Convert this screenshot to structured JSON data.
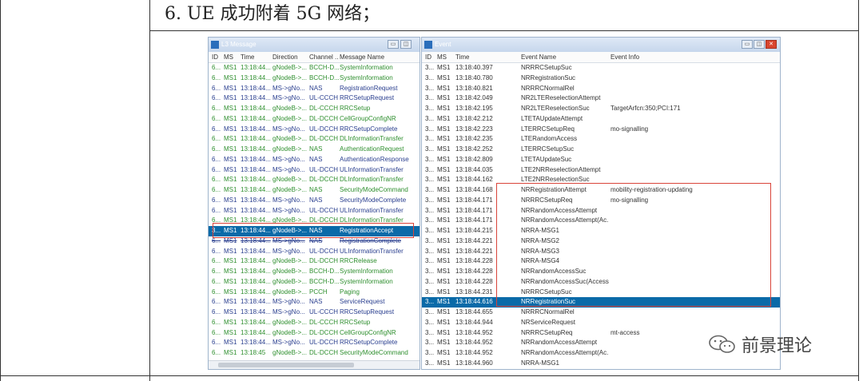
{
  "heading": "6.  UE 成功附着 5G 网络；",
  "l3_window": {
    "title": "L3 Message",
    "buttons": [
      "▭",
      "◫",
      "✕"
    ],
    "columns": [
      "ID",
      "MS",
      "Time",
      "Direction",
      "Channel ...",
      "Message Name"
    ],
    "rows": [
      [
        "6...",
        "MS1",
        "13:18:44...",
        "gNodeB->...",
        "BCCH-D...",
        "SystemInformation",
        "dl"
      ],
      [
        "6...",
        "MS1",
        "13:18:44...",
        "gNodeB->...",
        "BCCH-D...",
        "SystemInformation",
        "dl"
      ],
      [
        "6...",
        "MS1",
        "13:18:44...",
        "MS->gNo...",
        "NAS",
        "RegistrationRequest",
        "ul"
      ],
      [
        "6...",
        "MS1",
        "13:18:44...",
        "MS->gNo...",
        "UL-CCCH",
        "RRCSetupRequest",
        "ul"
      ],
      [
        "6...",
        "MS1",
        "13:18:44...",
        "gNodeB->...",
        "DL-CCCH",
        "RRCSetup",
        "dl"
      ],
      [
        "6...",
        "MS1",
        "13:18:44...",
        "gNodeB->...",
        "DL-DCCH",
        "CellGroupConfigNR",
        "dl"
      ],
      [
        "6...",
        "MS1",
        "13:18:44...",
        "MS->gNo...",
        "UL-DCCH",
        "RRCSetupComplete",
        "ul"
      ],
      [
        "6...",
        "MS1",
        "13:18:44...",
        "gNodeB->...",
        "DL-DCCH",
        "DLInformationTransfer",
        "dl"
      ],
      [
        "6...",
        "MS1",
        "13:18:44...",
        "gNodeB->...",
        "NAS",
        "AuthenticationRequest",
        "dl"
      ],
      [
        "6...",
        "MS1",
        "13:18:44...",
        "MS->gNo...",
        "NAS",
        "AuthenticationResponse",
        "ul"
      ],
      [
        "6...",
        "MS1",
        "13:18:44...",
        "MS->gNo...",
        "UL-DCCH",
        "ULInformationTransfer",
        "ul"
      ],
      [
        "6...",
        "MS1",
        "13:18:44...",
        "gNodeB->...",
        "DL-DCCH",
        "DLInformationTransfer",
        "dl"
      ],
      [
        "6...",
        "MS1",
        "13:18:44...",
        "gNodeB->...",
        "NAS",
        "SecurityModeCommand",
        "dl"
      ],
      [
        "6...",
        "MS1",
        "13:18:44...",
        "MS->gNo...",
        "NAS",
        "SecurityModeComplete",
        "ul"
      ],
      [
        "6...",
        "MS1",
        "13:18:44...",
        "MS->gNo...",
        "UL-DCCH",
        "ULInformationTransfer",
        "ul"
      ],
      [
        "6...",
        "MS1",
        "13:18:44...",
        "gNodeB->...",
        "DL-DCCH",
        "DLInformationTransfer",
        "dl"
      ],
      [
        "3...",
        "MS1",
        "13:18:44...",
        "gNodeB->...",
        "NAS",
        "RegistrationAccept",
        "sel"
      ],
      [
        "6...",
        "MS1",
        "13:18:44...",
        "MS->gNo...",
        "NAS",
        "RegistrationComplete",
        "ul strike"
      ],
      [
        "6...",
        "MS1",
        "13:18:44...",
        "MS->gNo...",
        "UL-DCCH",
        "ULInformationTransfer",
        "ul"
      ],
      [
        "6...",
        "MS1",
        "13:18:44...",
        "gNodeB->...",
        "DL-DCCH",
        "RRCRelease",
        "dl"
      ],
      [
        "6...",
        "MS1",
        "13:18:44...",
        "gNodeB->...",
        "BCCH-D...",
        "SystemInformation",
        "dl"
      ],
      [
        "6...",
        "MS1",
        "13:18:44...",
        "gNodeB->...",
        "BCCH-D...",
        "SystemInformation",
        "dl"
      ],
      [
        "6...",
        "MS1",
        "13:18:44...",
        "gNodeB->...",
        "PCCH",
        "Paging",
        "dl"
      ],
      [
        "6...",
        "MS1",
        "13:18:44...",
        "MS->gNo...",
        "NAS",
        "ServiceRequest",
        "ul"
      ],
      [
        "6...",
        "MS1",
        "13:18:44...",
        "MS->gNo...",
        "UL-CCCH",
        "RRCSetupRequest",
        "ul"
      ],
      [
        "6...",
        "MS1",
        "13:18:44...",
        "gNodeB->...",
        "DL-CCCH",
        "RRCSetup",
        "dl"
      ],
      [
        "6...",
        "MS1",
        "13:18:44...",
        "gNodeB->...",
        "DL-DCCH",
        "CellGroupConfigNR",
        "dl"
      ],
      [
        "6...",
        "MS1",
        "13:18:44...",
        "MS->gNo...",
        "UL-DCCH",
        "RRCSetupComplete",
        "ul"
      ],
      [
        "6...",
        "MS1",
        "13:18:45",
        "gNodeB->...",
        "DL-DCCH",
        "SecurityModeCommand",
        "dl"
      ]
    ]
  },
  "event_window": {
    "title": "Event",
    "buttons": [
      "▭",
      "◫",
      "✕"
    ],
    "columns": [
      "ID",
      "MS",
      "Time",
      "Event Name",
      "Event Info"
    ],
    "rows": [
      [
        "3...",
        "MS1",
        "13:18:40.397",
        "NRRRCSetupSuc",
        "",
        ""
      ],
      [
        "3...",
        "MS1",
        "13:18:40.780",
        "NRRegistrationSuc",
        "",
        ""
      ],
      [
        "3...",
        "MS1",
        "13:18:40.821",
        "NRRRCNormalRel",
        "",
        ""
      ],
      [
        "3...",
        "MS1",
        "13:18:42.049",
        "NR2LTEReselectionAttempt",
        "",
        ""
      ],
      [
        "3...",
        "MS1",
        "13:18:42.195",
        "NR2LTEReselectionSuc",
        "TargetArfcn:350;PCI:171",
        ""
      ],
      [
        "3...",
        "MS1",
        "13:18:42.212",
        "LTETAUpdateAttempt",
        "",
        ""
      ],
      [
        "3...",
        "MS1",
        "13:18:42.223",
        "LTERRCSetupReq",
        "mo-signalling",
        ""
      ],
      [
        "3...",
        "MS1",
        "13:18:42.235",
        "LTERandomAccess",
        "",
        ""
      ],
      [
        "3...",
        "MS1",
        "13:18:42.252",
        "LTERRCSetupSuc",
        "",
        ""
      ],
      [
        "3...",
        "MS1",
        "13:18:42.809",
        "LTETAUpdateSuc",
        "",
        ""
      ],
      [
        "3...",
        "MS1",
        "13:18:44.035",
        "LTE2NRReselectionAttempt",
        "",
        ""
      ],
      [
        "3...",
        "MS1",
        "13:18:44.162",
        "LTE2NRReselectionSuc",
        "",
        ""
      ],
      [
        "3...",
        "MS1",
        "13:18:44.168",
        "NRRegistrationAttempt",
        "mobility-registration-updating",
        ""
      ],
      [
        "3...",
        "MS1",
        "13:18:44.171",
        "NRRRCSetupReq",
        "mo-signalling",
        ""
      ],
      [
        "3...",
        "MS1",
        "13:18:44.171",
        "NRRandomAccessAttempt",
        "",
        ""
      ],
      [
        "3...",
        "MS1",
        "13:18:44.171",
        "NRRandomAccessAttempt(Ac...",
        "",
        ""
      ],
      [
        "3...",
        "MS1",
        "13:18:44.215",
        "NRRA-MSG1",
        "",
        ""
      ],
      [
        "3...",
        "MS1",
        "13:18:44.221",
        "NRRA-MSG2",
        "",
        ""
      ],
      [
        "3...",
        "MS1",
        "13:18:44.221",
        "NRRA-MSG3",
        "",
        ""
      ],
      [
        "3...",
        "MS1",
        "13:18:44.228",
        "NRRA-MSG4",
        "",
        ""
      ],
      [
        "3...",
        "MS1",
        "13:18:44.228",
        "NRRandomAccessSuc",
        "",
        ""
      ],
      [
        "3...",
        "MS1",
        "13:18:44.228",
        "NRRandomAccessSuc(Access)",
        "",
        ""
      ],
      [
        "3...",
        "MS1",
        "13:18:44.231",
        "NRRRCSetupSuc",
        "",
        ""
      ],
      [
        "3...",
        "MS1",
        "13:18:44.616",
        "NRRegistrationSuc",
        "",
        "sel"
      ],
      [
        "3...",
        "MS1",
        "13:18:44.655",
        "NRRRCNormalRel",
        "",
        ""
      ],
      [
        "3...",
        "MS1",
        "13:18:44.944",
        "NRServiceRequest",
        "",
        ""
      ],
      [
        "3...",
        "MS1",
        "13:18:44.952",
        "NRRRCSetupReq",
        "mt-access",
        ""
      ],
      [
        "3...",
        "MS1",
        "13:18:44.952",
        "NRRandomAccessAttempt",
        "",
        ""
      ],
      [
        "3...",
        "MS1",
        "13:18:44.952",
        "NRRandomAccessAttempt(Ac...",
        "",
        ""
      ],
      [
        "3...",
        "MS1",
        "13:18:44.960",
        "NRRA-MSG1",
        "",
        ""
      ]
    ]
  },
  "watermark": {
    "text": "前景理论",
    "icon": "wechat-icon"
  }
}
